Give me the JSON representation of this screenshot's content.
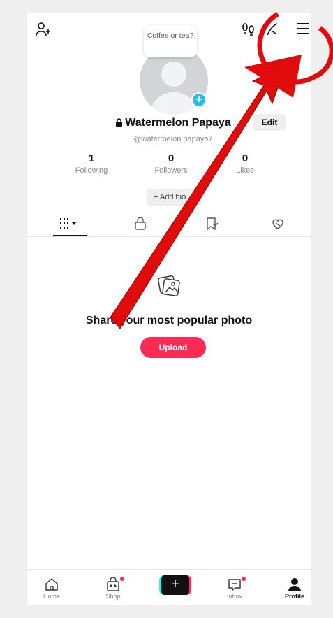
{
  "topbar": {
    "add_friend_icon": "person-plus-icon",
    "footprints_icon": "footprints-icon",
    "creator_icon": "creator-tools-icon",
    "menu_icon": "hamburger-menu-icon"
  },
  "profile": {
    "note_bubble": "Coffee or tea?",
    "display_name": "Watermelon Papaya",
    "lock_icon": "lock-icon",
    "username": "@watermelon.papaya7",
    "edit_label": "Edit",
    "add_bio_label": "+ Add bio"
  },
  "stats": [
    {
      "value": "1",
      "label": "Following"
    },
    {
      "value": "0",
      "label": "Followers"
    },
    {
      "value": "0",
      "label": "Likes"
    }
  ],
  "tabs": [
    {
      "name": "videos-grid",
      "icon": "grid-icon"
    },
    {
      "name": "private",
      "icon": "lock-icon"
    },
    {
      "name": "reposts",
      "icon": "repost-icon"
    },
    {
      "name": "liked",
      "icon": "liked-heart-icon"
    }
  ],
  "empty_state": {
    "icon": "photo-icon",
    "message": "Share your most popular photo",
    "upload_label": "Upload"
  },
  "bottom_nav": [
    {
      "label": "Home",
      "icon": "home-icon"
    },
    {
      "label": "Shop",
      "icon": "shop-icon"
    },
    {
      "label": "",
      "icon": "create-plus-icon"
    },
    {
      "label": "Inbox",
      "icon": "inbox-icon"
    },
    {
      "label": "Profile",
      "icon": "profile-icon"
    }
  ],
  "colors": {
    "accent": "#fe2c55",
    "annotation_arrow": "#e00b0b",
    "verified_blue": "#23bdf0"
  }
}
